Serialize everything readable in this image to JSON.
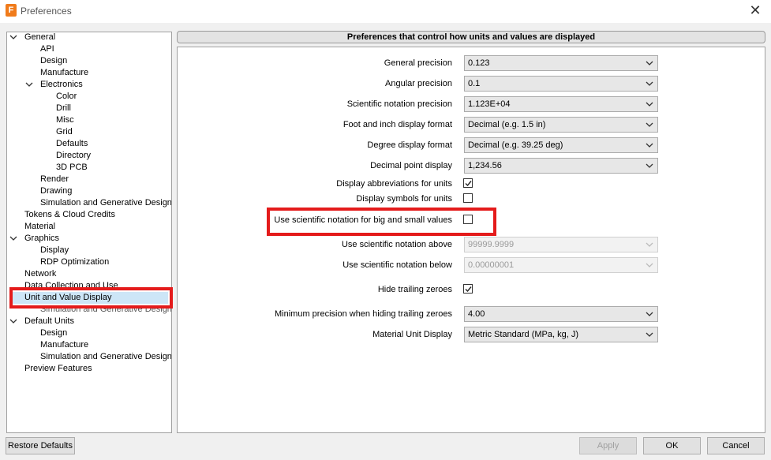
{
  "window": {
    "title": "Preferences",
    "app_icon_letter": "F"
  },
  "tree": {
    "items": [
      {
        "label": "General",
        "expanded": true
      },
      {
        "label": "API"
      },
      {
        "label": "Design"
      },
      {
        "label": "Manufacture"
      },
      {
        "label": "Electronics",
        "expanded": true
      },
      {
        "label": "Color"
      },
      {
        "label": "Drill"
      },
      {
        "label": "Misc"
      },
      {
        "label": "Grid"
      },
      {
        "label": "Defaults"
      },
      {
        "label": "Directory"
      },
      {
        "label": "3D PCB"
      },
      {
        "label": "Render"
      },
      {
        "label": "Drawing"
      },
      {
        "label": "Simulation and Generative Design"
      },
      {
        "label": "Tokens & Cloud Credits"
      },
      {
        "label": "Material"
      },
      {
        "label": "Graphics",
        "expanded": true
      },
      {
        "label": "Display"
      },
      {
        "label": "RDP Optimization"
      },
      {
        "label": "Network"
      },
      {
        "label": "Data Collection and Use"
      },
      {
        "label": "Unit and Value Display",
        "selected": true
      },
      {
        "label": "Simulation and Generative Design"
      },
      {
        "label": "Default Units",
        "expanded": true
      },
      {
        "label": "Design"
      },
      {
        "label": "Manufacture"
      },
      {
        "label": "Simulation and Generative Design"
      },
      {
        "label": "Preview Features"
      }
    ]
  },
  "panel": {
    "header": "Preferences that control how units and values are displayed",
    "general_precision": {
      "label": "General precision",
      "value": "0.123"
    },
    "angular_precision": {
      "label": "Angular precision",
      "value": "0.1"
    },
    "sci_precision": {
      "label": "Scientific notation precision",
      "value": "1.123E+04"
    },
    "foot_inch_format": {
      "label": "Foot and inch display format",
      "value": "Decimal (e.g. 1.5 in)"
    },
    "degree_format": {
      "label": "Degree display format",
      "value": "Decimal (e.g. 39.25 deg)"
    },
    "decimal_point": {
      "label": "Decimal point display",
      "value": "1,234.56"
    },
    "display_abbrev": {
      "label": "Display abbreviations for units",
      "checked": true
    },
    "display_symbols": {
      "label": "Display symbols for units",
      "checked": false
    },
    "use_sci": {
      "label": "Use scientific notation for big and small values",
      "checked": false
    },
    "sci_above": {
      "label": "Use scientific notation above",
      "value": "99999.9999"
    },
    "sci_below": {
      "label": "Use scientific notation below",
      "value": "0.00000001"
    },
    "hide_zeroes": {
      "label": "Hide trailing zeroes",
      "checked": true
    },
    "min_precision": {
      "label": "Minimum precision when hiding trailing zeroes",
      "value": "4.00"
    },
    "material_unit": {
      "label": "Material Unit Display",
      "value": "Metric Standard (MPa, kg, J)"
    }
  },
  "buttons": {
    "restore": "Restore Defaults",
    "apply": "Apply",
    "ok": "OK",
    "cancel": "Cancel"
  },
  "colors": {
    "highlight": "#e41b1b",
    "accent_icon": "#f07b1b"
  }
}
